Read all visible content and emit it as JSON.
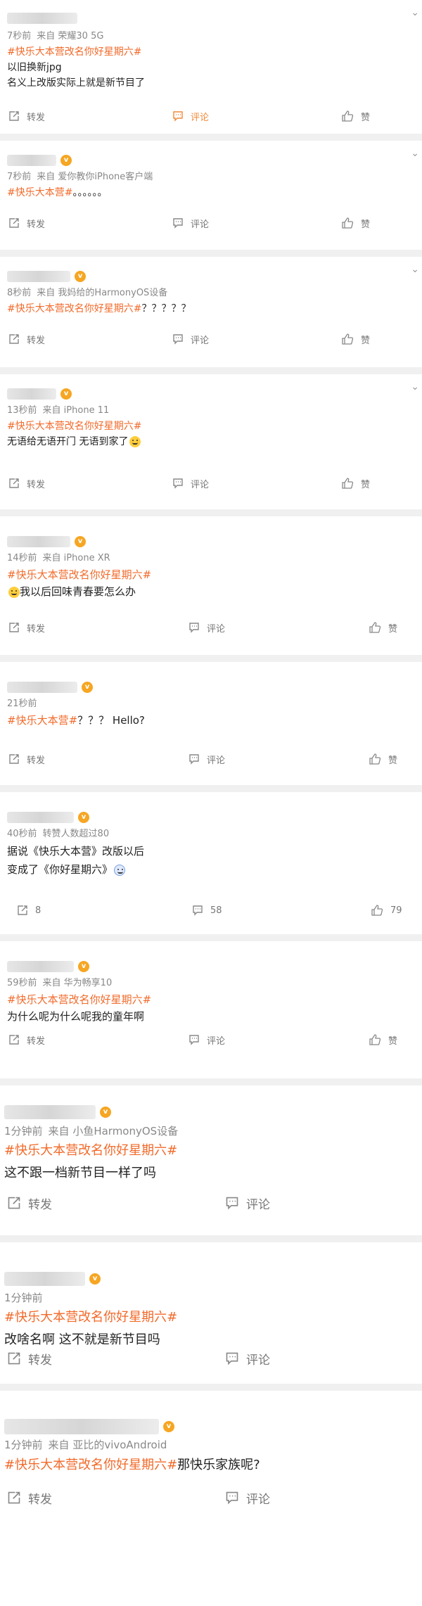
{
  "posts": [
    {
      "time": "7秒前",
      "source": "来自 荣耀30 5G",
      "topic": "#快乐大本营改名你好星期六#",
      "text_after": "",
      "lines": [
        "以旧换新jpg",
        "名义上改版实际上就是新节目了"
      ],
      "repost": "转发",
      "comment": "评论",
      "like": "赞"
    },
    {
      "time": "7秒前",
      "source": "来自 爱你教你iPhone客户端",
      "topic": "#快乐大本营#",
      "text_after": "。。。。。。",
      "lines": [],
      "repost": "转发",
      "comment": "评论",
      "like": "赞"
    },
    {
      "time": "8秒前",
      "source": "来自 我妈给的HarmonyOS设备",
      "topic": "#快乐大本营改名你好星期六#",
      "text_after": "？？？？？",
      "lines": [],
      "repost": "转发",
      "comment": "评论",
      "like": "赞"
    },
    {
      "time": "13秒前",
      "source": "来自 iPhone 11",
      "topic": "#快乐大本营改名你好星期六#",
      "text_after": "",
      "lines": [
        "无语给无语开门 无语到家了"
      ],
      "repost": "转发",
      "comment": "评论",
      "like": "赞"
    },
    {
      "time": "14秒前",
      "source": "来自 iPhone XR",
      "topic": "#快乐大本营改名你好星期六#",
      "text_after": "",
      "lines": [
        "我以后回味青春要怎么办"
      ],
      "repost": "转发",
      "comment": "评论",
      "like": "赞"
    },
    {
      "time": "21秒前",
      "source": "",
      "topic": "#快乐大本营#",
      "text_after": "？？？ Hello?",
      "lines": [],
      "repost": "转发",
      "comment": "评论",
      "like": "赞"
    },
    {
      "time": "40秒前",
      "source": "转赞人数超过80",
      "topic": "",
      "text_after": "",
      "lines": [
        "据说《快乐大本营》改版以后",
        "变成了《你好星期六》"
      ],
      "repost": "8",
      "comment": "58",
      "like": "79"
    },
    {
      "time": "59秒前",
      "source": "来自 华为畅享10",
      "topic": "#快乐大本营改名你好星期六#",
      "text_after": "",
      "lines": [
        "为什么呢为什么呢我的童年啊"
      ],
      "repost": "转发",
      "comment": "评论",
      "like": "赞"
    },
    {
      "time": "1分钟前",
      "source": "来自 小鱼HarmonyOS设备",
      "topic": "#快乐大本营改名你好星期六#",
      "text_after": "",
      "lines": [
        "这不跟一档新节目一样了吗"
      ],
      "repost": "转发",
      "comment": "评论",
      "like": ""
    },
    {
      "time": "1分钟前",
      "source": "",
      "topic": "#快乐大本营改名你好星期六#",
      "text_after": "",
      "lines": [
        "改啥名啊 这不就是新节目吗"
      ],
      "repost": "转发",
      "comment": "评论",
      "like": ""
    },
    {
      "time": "1分钟前",
      "source": "来自 亚比的vivoAndroid",
      "topic": "#快乐大本营改名你好星期六#",
      "text_after": "那快乐家族呢?",
      "lines": [],
      "repost": "转发",
      "comment": "评论",
      "like": ""
    }
  ],
  "colors": {
    "topic": "#f26a2a",
    "highlight": "#f08a3b",
    "muted": "#888888"
  }
}
